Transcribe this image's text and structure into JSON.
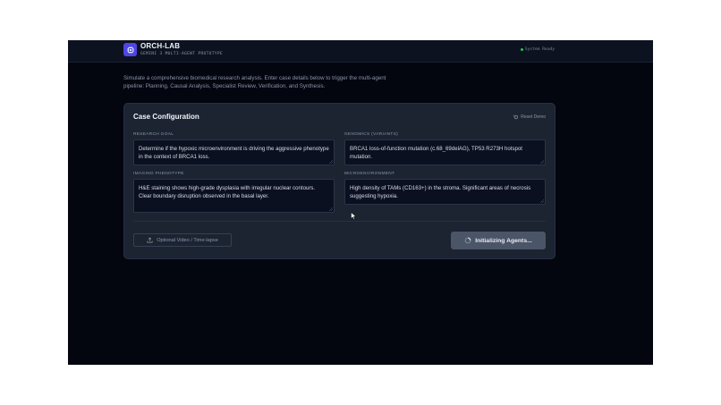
{
  "header": {
    "brand_title": "ORCH-LAB",
    "brand_subtitle": "GEMINI 3 MULTI-AGENT PROTOTYPE",
    "logo_icon": "cpu-icon",
    "status_text": "System Ready",
    "status_color": "#22c55e"
  },
  "intro": {
    "description": "Simulate a comprehensive biomedical research analysis. Enter case details below to trigger the multi-agent pipeline: Planning, Causal Analysis, Specialist Review, Verification, and Synthesis."
  },
  "case_config": {
    "title": "Case Configuration",
    "reset_label": "Reset Demo",
    "fields": {
      "research_goal": {
        "label": "RESEARCH GOAL",
        "value": "Determine if the hypoxic microenvironment is driving the aggressive phenotype in the context of BRCA1 loss."
      },
      "genomics": {
        "label": "GENOMICS (VARIANTS)",
        "value": "BRCA1 loss-of-function mutation (c.68_69delAG), TP53 R273H hotspot mutation."
      },
      "imaging": {
        "label": "IMAGING PHENOTYPE",
        "value": "H&E staining shows high-grade dysplasia with irregular nuclear contours. Clear boundary disruption observed in the basal layer."
      },
      "microenvironment": {
        "label": "MICROENVIRONMENT",
        "value": "High density of TAMs (CD163+) in the stroma. Significant areas of necrosis suggesting hypoxia."
      }
    },
    "upload_label": "Optional Video / Time-lapse",
    "run_label": "Initializing Agents..."
  },
  "colors": {
    "accent": "#4f46e5",
    "app_background": "#03050f",
    "card_background": "#1c2432",
    "button_background": "#4b5568"
  }
}
